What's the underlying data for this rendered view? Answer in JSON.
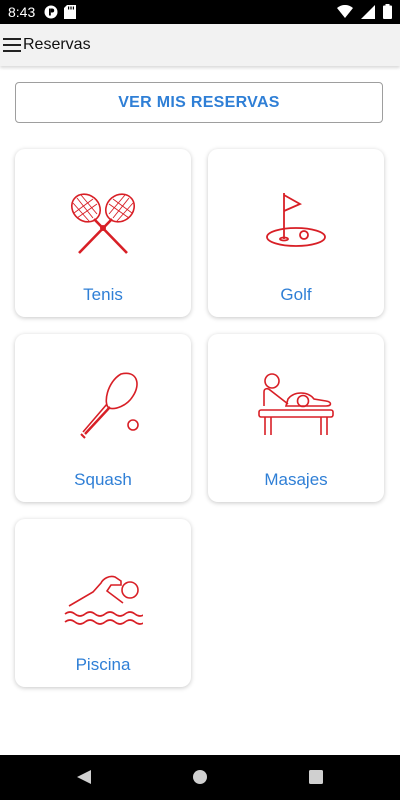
{
  "status_bar": {
    "time": "8:43"
  },
  "app_bar": {
    "title": "Reservas"
  },
  "reservas_button": {
    "label": "VER MIS RESERVAS"
  },
  "categories": [
    {
      "label": "Tenis",
      "icon": "tennis-rackets-icon"
    },
    {
      "label": "Golf",
      "icon": "golf-flag-icon"
    },
    {
      "label": "Squash",
      "icon": "squash-racket-icon"
    },
    {
      "label": "Masajes",
      "icon": "massage-icon"
    },
    {
      "label": "Piscina",
      "icon": "swimmer-icon"
    }
  ],
  "colors": {
    "accent_text": "#2f7fd6",
    "icon_red": "#d81f26"
  }
}
